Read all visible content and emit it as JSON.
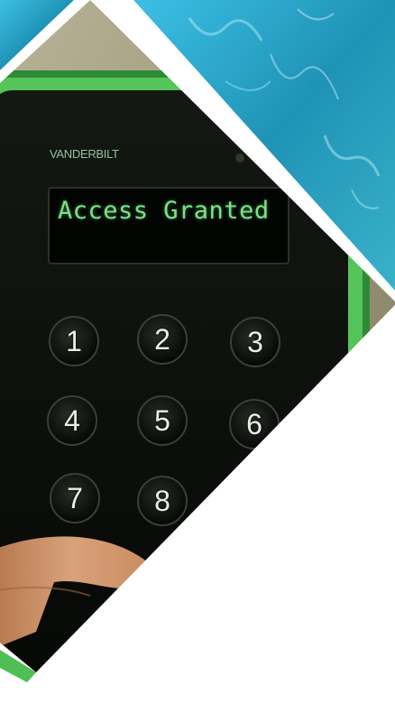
{
  "reader": {
    "brand": "VANDERBILT",
    "display_text": "Access Granted",
    "keys": [
      "1",
      "2",
      "3",
      "4",
      "5",
      "6",
      "7",
      "8"
    ]
  },
  "colors": {
    "water": "#2aa8cc",
    "frame_green": "#4fbf55",
    "lcd_text": "#7fe08a",
    "device_body": "#0c0f0b",
    "hand_skin": "#c98f63"
  }
}
